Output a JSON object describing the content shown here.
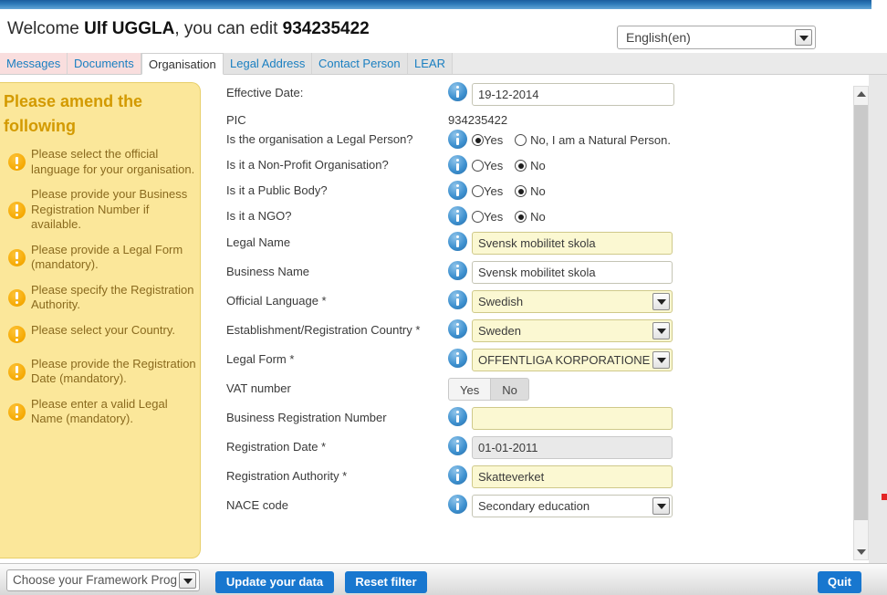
{
  "topbar": {
    "present": true
  },
  "header": {
    "welcome_prefix": "Welcome ",
    "user_name": "Ulf UGGLA",
    "welcome_middle": ", you can edit ",
    "pic_number": "934235422",
    "language_value": "English(en)"
  },
  "tabs": [
    {
      "label": "Messages",
      "state": "alert"
    },
    {
      "label": "Documents",
      "state": "alert"
    },
    {
      "label": "Organisation",
      "state": "active"
    },
    {
      "label": "Legal Address",
      "state": "plain"
    },
    {
      "label": "Contact Person",
      "state": "plain"
    },
    {
      "label": "LEAR",
      "state": "plain"
    }
  ],
  "sidebar": {
    "title": "Please amend the following",
    "warnings": [
      "Please select the official language for your organisation.",
      "Please provide your Business Registration Number if available.",
      "Please provide a Legal Form (mandatory).",
      "Please specify the Registration Authority.",
      "Please select your Country.",
      "Please provide the Registration Date (mandatory).",
      "Please enter a valid Legal Name (mandatory)."
    ]
  },
  "form": {
    "effective_date": {
      "label": "Effective Date:",
      "value": "19-12-2014"
    },
    "pic": {
      "label": "PIC",
      "value": "934235422"
    },
    "legal_person": {
      "label": "Is the organisation a Legal Person?",
      "option_yes": "Yes",
      "option_no": "No, I am a Natural Person.",
      "selected": "yes"
    },
    "non_profit": {
      "label": "Is it a Non-Profit Organisation?",
      "option_yes": "Yes",
      "option_no": "No",
      "selected": "no"
    },
    "public_body": {
      "label": "Is it a Public Body?",
      "option_yes": "Yes",
      "option_no": "No",
      "selected": "no"
    },
    "ngo": {
      "label": "Is it a NGO?",
      "option_yes": "Yes",
      "option_no": "No",
      "selected": "no"
    },
    "legal_name": {
      "label": "Legal Name",
      "value": "Svensk mobilitet skola"
    },
    "business_name": {
      "label": "Business Name",
      "value": "Svensk mobilitet skola"
    },
    "official_language": {
      "label": "Official Language *",
      "value": "Swedish"
    },
    "country": {
      "label": "Establishment/Registration Country *",
      "value": "Sweden"
    },
    "legal_form": {
      "label": "Legal Form *",
      "value": "OFFENTLIGA KORPORATIONE"
    },
    "vat_number": {
      "label": "VAT number",
      "option_yes": "Yes",
      "option_no": "No",
      "selected": "no"
    },
    "business_registration_number": {
      "label": "Business Registration Number",
      "value": ""
    },
    "registration_date": {
      "label": "Registration Date *",
      "value": "01-01-2011"
    },
    "registration_authority": {
      "label": "Registration Authority *",
      "value": "Skatteverket"
    },
    "nace_code": {
      "label": "NACE code",
      "value": "Secondary education"
    }
  },
  "footer": {
    "framework_select": "Choose your Framework Program",
    "update_label": "Update your data",
    "reset_label": "Reset filter",
    "quit_label": "Quit"
  },
  "colors": {
    "accent_blue": "#1877cf",
    "tab_link": "#1a7fc1",
    "sidebar_bg": "#fbe79a",
    "sidebar_title": "#d39a00",
    "warning_orange": "#f5a800",
    "required_field": "#fbf8d2",
    "alert_tab": "#f9dede"
  }
}
